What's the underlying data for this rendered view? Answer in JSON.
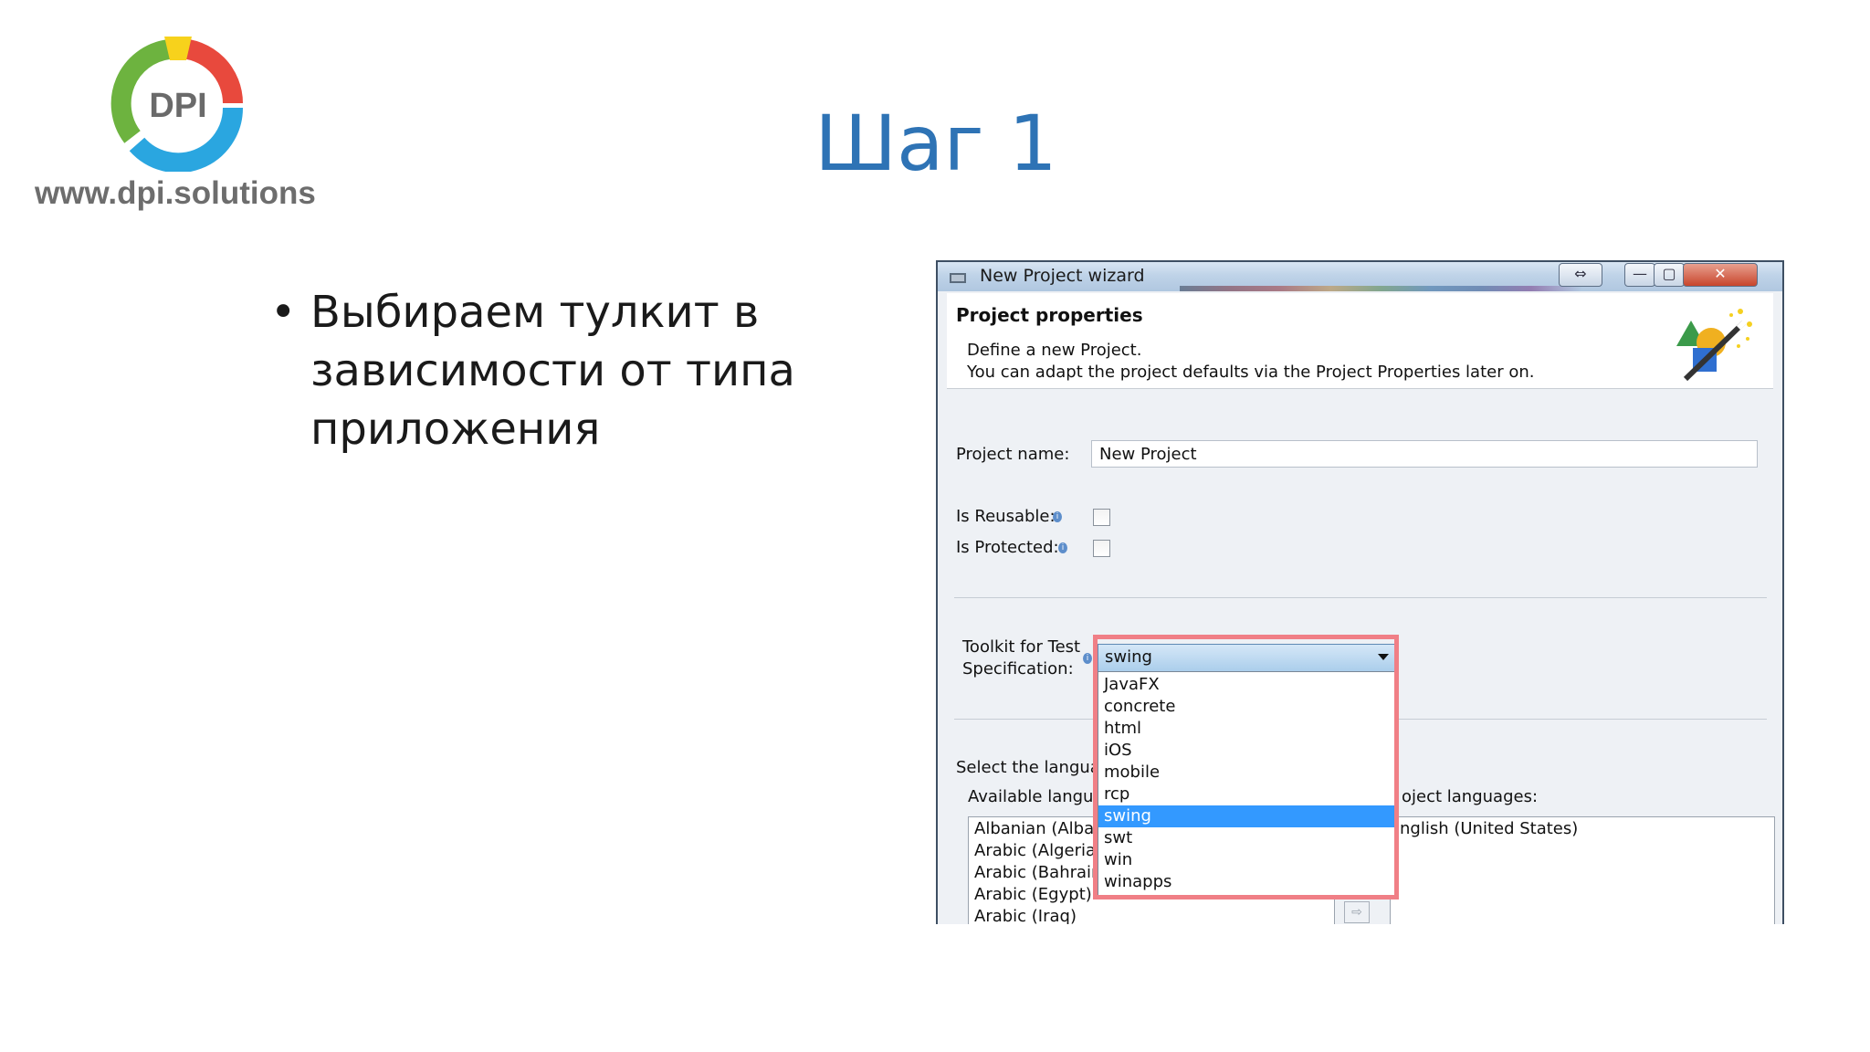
{
  "slide": {
    "logo_text": "DPI",
    "logo_url": "www.dpi.solutions",
    "title": "Шаг 1",
    "bullet_lines": [
      "Выбираем тулкит в",
      "зависимости от типа",
      "приложения"
    ]
  },
  "window": {
    "title": "New Project wizard",
    "controls": [
      "⇔",
      "—",
      "▢",
      "✕"
    ],
    "header": {
      "title": "Project properties",
      "line1": "Define a new Project.",
      "line2": "You can adapt the project defaults via the Project Properties later on."
    },
    "project_name_label": "Project name:",
    "project_name_value": "New Project",
    "is_reusable_label": "Is Reusable:",
    "is_protected_label": "Is Protected:",
    "toolkit_label_line1": "Toolkit for Test",
    "toolkit_label_line2": "Specification:",
    "toolkit_selected": "swing",
    "toolkit_options": [
      "JavaFX",
      "concrete",
      "html",
      "iOS",
      "mobile",
      "rcp",
      "swing",
      "swt",
      "win",
      "winapps"
    ],
    "toolkit_selected_index": 6,
    "select_language_label": "Select the languag",
    "available_languages_label": "Available langua",
    "project_languages_label": "oject languages:",
    "available_languages": [
      "Albanian (Alban",
      "Arabic (Algeria)",
      "Arabic (Bahrain",
      "Arabic (Egypt)",
      "Arabic (Iraq)"
    ],
    "project_languages": [
      "nglish (United States)"
    ],
    "arrow_glyph": "⇨"
  }
}
